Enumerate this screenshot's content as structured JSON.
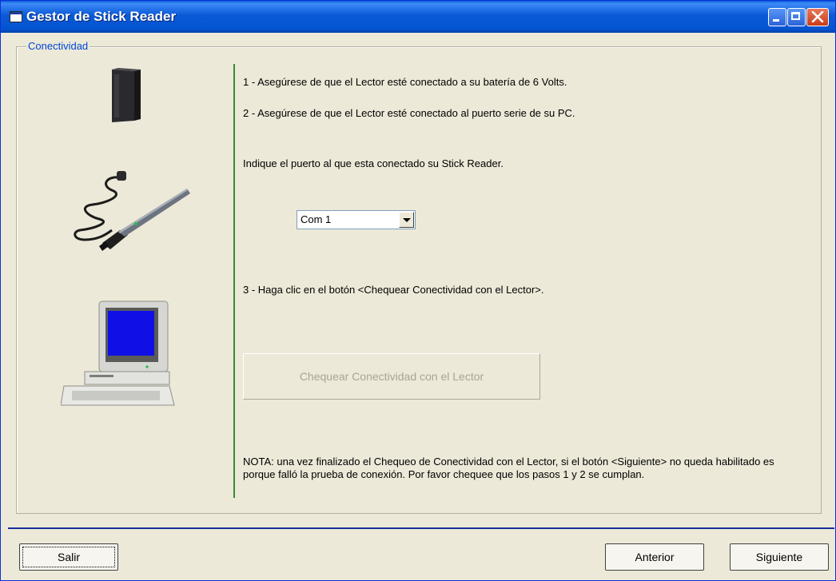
{
  "window": {
    "title": "Gestor de Stick Reader"
  },
  "group": {
    "label": "Conectividad"
  },
  "steps": {
    "step1": "1 - Asegúrese de que el Lector esté conectado a su batería de 6 Volts.",
    "step2": "2 - Asegúrese de que el Lector esté conectado al puerto serie de su PC.",
    "port_prompt": "Indique el puerto al que esta conectado su Stick Reader.",
    "step3": "3 - Haga clic en el botón <Chequear Conectividad con el Lector>."
  },
  "port_select": {
    "value": "Com 1"
  },
  "check_button": {
    "label": "Chequear Conectividad con el Lector",
    "enabled": false
  },
  "note": "NOTA: una vez finalizado el Chequeo de Conectividad con el Lector, si el botón <Siguiente> no queda habilitado es porque falló la prueba de conexión. Por favor chequee que los pasos 1 y 2 se cumplan.",
  "footer": {
    "exit_label": "Salir",
    "prev_label": "Anterior",
    "next_label": "Siguiente"
  },
  "icons": [
    "battery-icon",
    "stick-reader-icon",
    "computer-icon"
  ],
  "colors": {
    "titlebar": "#0a5ad7",
    "group_label": "#0046d5",
    "divider": "#2f8f2f"
  }
}
